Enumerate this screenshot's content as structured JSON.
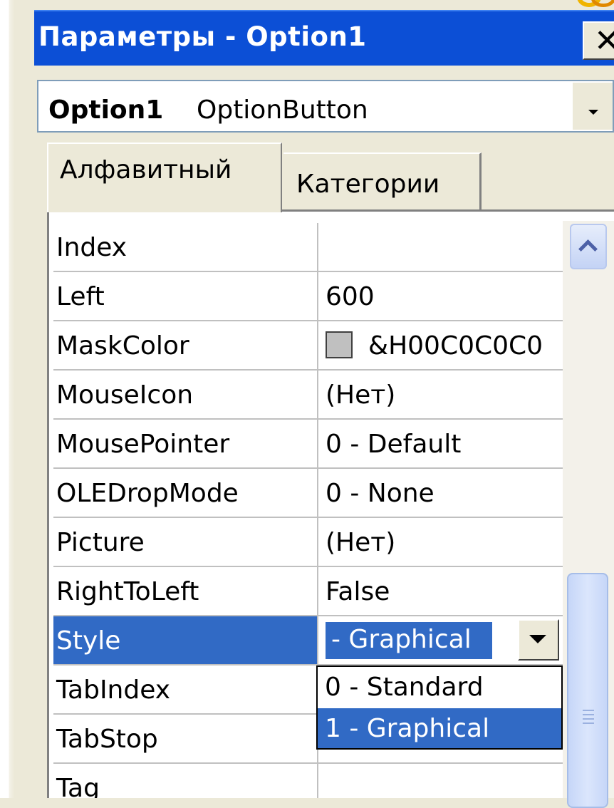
{
  "window": {
    "title": "Параметры - Option1",
    "close_icon": "close-icon"
  },
  "object_selector": {
    "name": "Option1",
    "type": "OptionButton"
  },
  "tabs": [
    {
      "label": "Алфавитный",
      "active": true
    },
    {
      "label": "Категории",
      "active": false
    }
  ],
  "properties": [
    {
      "name": "Index",
      "value": ""
    },
    {
      "name": "Left",
      "value": "600"
    },
    {
      "name": "MaskColor",
      "value": "&H00C0C0C0",
      "swatch": "#c0c0c0"
    },
    {
      "name": "MouseIcon",
      "value": "(Нет)"
    },
    {
      "name": "MousePointer",
      "value": "0 - Default"
    },
    {
      "name": "OLEDropMode",
      "value": "0 - None"
    },
    {
      "name": "Picture",
      "value": "(Нет)"
    },
    {
      "name": "RightToLeft",
      "value": "False"
    },
    {
      "name": "Style",
      "value": "- Graphical",
      "selected": true
    },
    {
      "name": "TabIndex",
      "value": ""
    },
    {
      "name": "TabStop",
      "value": ""
    },
    {
      "name": "Tag",
      "value": ""
    }
  ],
  "style_dropdown": {
    "options": [
      "0 - Standard",
      "1 - Graphical"
    ],
    "selected_index": 1
  },
  "colors": {
    "titlebar": "#0c4fd6",
    "selection": "#316ac5",
    "face": "#ece9d8"
  }
}
